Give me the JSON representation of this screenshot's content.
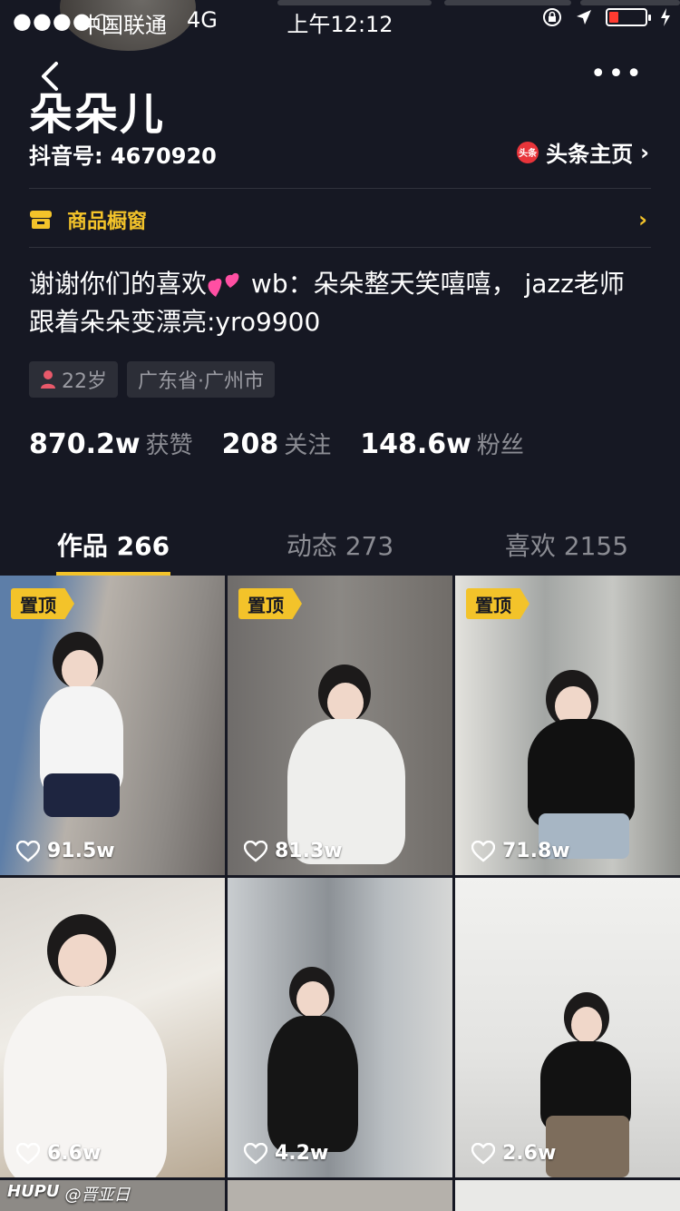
{
  "status_bar": {
    "signal": "●●●●○",
    "carrier": "中国联通",
    "network": "4G",
    "time": "上午12:12"
  },
  "profile": {
    "nickname": "朵朵儿",
    "douyin_id": "抖音号: 4670920",
    "toutiao_badge": "头条",
    "toutiao_link": "头条主页",
    "shop_label": "商品橱窗",
    "bio_line1_a": "谢谢你们的喜欢",
    "bio_line1_b": " wb：朵朵整天笑嘻嘻， jazz老师 跟着朵朵变漂亮:yro9900",
    "tags": {
      "age": "22岁",
      "location": "广东省·广州市"
    },
    "stats": [
      {
        "num": "870.2w",
        "label": "获赞"
      },
      {
        "num": "208",
        "label": "关注"
      },
      {
        "num": "148.6w",
        "label": "粉丝"
      }
    ]
  },
  "tabs": [
    {
      "label": "作品 266",
      "active": true
    },
    {
      "label": "动态 273",
      "active": false
    },
    {
      "label": "喜欢 2155",
      "active": false
    }
  ],
  "videos": [
    {
      "pinned": "置顶",
      "likes": "91.5w"
    },
    {
      "pinned": "置顶",
      "likes": "81.3w"
    },
    {
      "pinned": "置顶",
      "likes": "71.8w"
    },
    {
      "pinned": "",
      "likes": "6.6w"
    },
    {
      "pinned": "",
      "likes": "4.2w"
    },
    {
      "pinned": "",
      "likes": "2.6w"
    }
  ],
  "watermark": {
    "brand": "HUPU",
    "handle": "@晋亚日"
  },
  "colors": {
    "accent": "#f3c32a",
    "background": "#161823",
    "muted": "#8b8c93"
  }
}
